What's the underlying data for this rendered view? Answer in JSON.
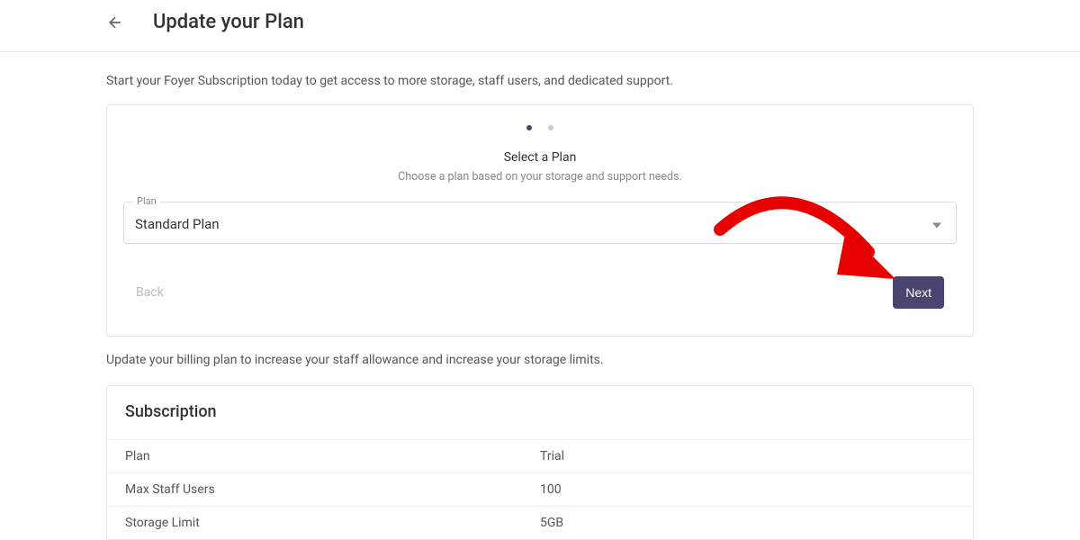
{
  "header": {
    "title": "Update your Plan"
  },
  "intro": "Start your Foyer Subscription today to get access to more storage, staff users, and dedicated support.",
  "wizard": {
    "step_title": "Select a Plan",
    "step_subtitle": "Choose a plan based on your storage and support needs.",
    "plan_label": "Plan",
    "plan_value": "Standard Plan",
    "back_label": "Back",
    "next_label": "Next"
  },
  "update_text": "Update your billing plan to increase your staff allowance and increase your storage limits.",
  "subscription": {
    "title": "Subscription",
    "rows": [
      {
        "key": "Plan",
        "value": "Trial"
      },
      {
        "key": "Max Staff Users",
        "value": "100"
      },
      {
        "key": "Storage Limit",
        "value": "5GB"
      }
    ]
  },
  "colors": {
    "primary": "#4a4570",
    "annotation": "#e60000"
  }
}
